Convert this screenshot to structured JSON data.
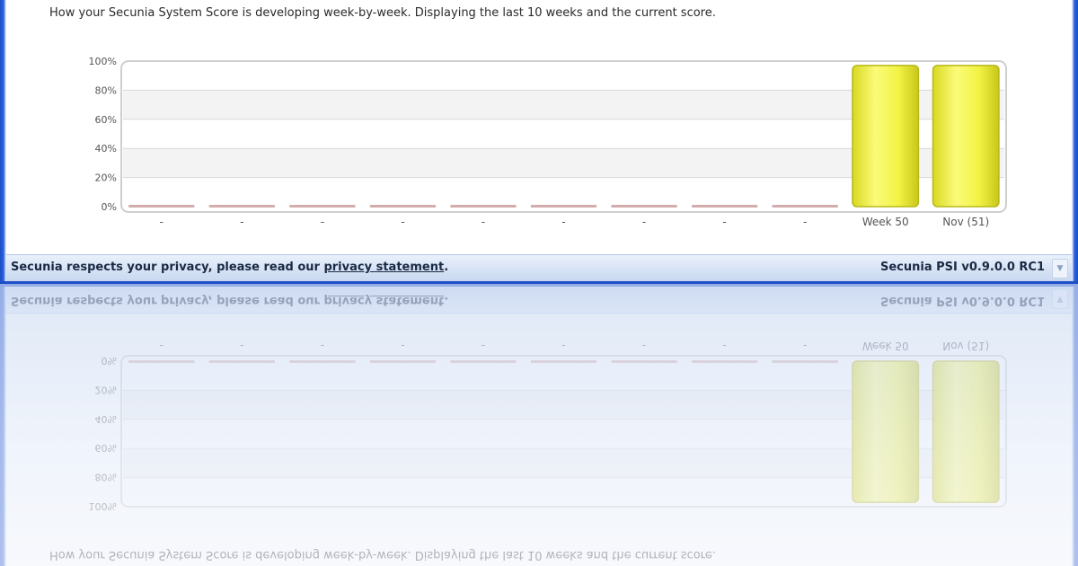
{
  "description": "How your Secunia System Score is developing week-by-week. Displaying the last 10 weeks and the current score.",
  "chart_data": {
    "type": "bar",
    "categories": [
      "-",
      "-",
      "-",
      "-",
      "-",
      "-",
      "-",
      "-",
      "-",
      "Week 50",
      "Nov (51)"
    ],
    "values": [
      0,
      0,
      0,
      0,
      0,
      0,
      0,
      0,
      0,
      97,
      97
    ],
    "y_ticks": [
      "0%",
      "20%",
      "40%",
      "60%",
      "80%",
      "100%"
    ],
    "ylim": [
      0,
      100
    ],
    "grid": true,
    "colors": {
      "bar": "#eef04a",
      "bar_edge": "#b8b818",
      "empty_bar": "#c08a8a",
      "grid": "#d8d8d8"
    }
  },
  "footer": {
    "privacy_prefix": "Secunia respects your privacy, please read our ",
    "privacy_link": "privacy statement",
    "privacy_suffix": ".",
    "version": "Secunia PSI v0.9.0.0 RC1"
  },
  "icons": {
    "scroll_down": "chevron-down-icon"
  }
}
